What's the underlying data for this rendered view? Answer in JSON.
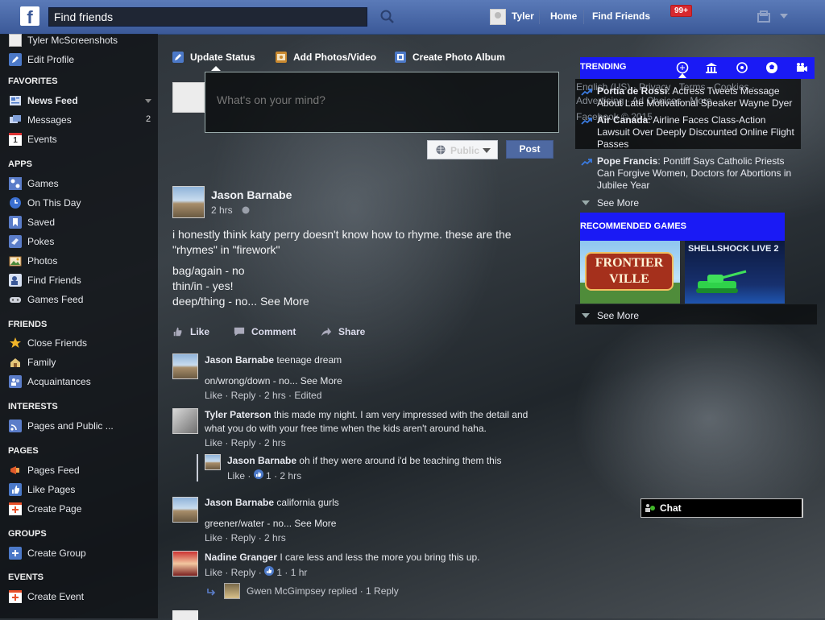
{
  "header": {
    "search_placeholder": "Find friends",
    "user_name": "Tyler",
    "home": "Home",
    "find_friends": "Find Friends",
    "notif_count": "99+"
  },
  "sidebar": {
    "profile_name": "Tyler McScreenshots",
    "edit_profile": "Edit Profile",
    "favorites_title": "FAVORITES",
    "favorites": [
      {
        "label": "News Feed",
        "icon": "news-feed-icon"
      },
      {
        "label": "Messages",
        "icon": "messages-icon",
        "count": "2"
      },
      {
        "label": "Events",
        "icon": "events-icon"
      }
    ],
    "events_icon_text": "1",
    "apps_title": "APPS",
    "apps": [
      {
        "label": "Games"
      },
      {
        "label": "On This Day"
      },
      {
        "label": "Saved"
      },
      {
        "label": "Pokes"
      },
      {
        "label": "Photos"
      },
      {
        "label": "Find Friends"
      },
      {
        "label": "Games Feed"
      }
    ],
    "friends_title": "FRIENDS",
    "friends": [
      {
        "label": "Close Friends"
      },
      {
        "label": "Family"
      },
      {
        "label": "Acquaintances"
      }
    ],
    "interests_title": "INTERESTS",
    "interests": [
      {
        "label": "Pages and Public ..."
      }
    ],
    "pages_title": "PAGES",
    "pages": [
      {
        "label": "Pages Feed"
      },
      {
        "label": "Like Pages"
      },
      {
        "label": "Create Page"
      }
    ],
    "groups_title": "GROUPS",
    "groups": [
      {
        "label": "Create Group"
      }
    ],
    "events_title": "EVENTS",
    "events": [
      {
        "label": "Create Event"
      }
    ]
  },
  "composer": {
    "tabs": [
      "Update Status",
      "Add Photos/Video",
      "Create Photo Album"
    ],
    "placeholder": "What's on your mind?",
    "privacy": "Public",
    "post": "Post"
  },
  "post": {
    "author": "Jason Barnabe",
    "time": "2 hrs",
    "text1": "i honestly think katy perry doesn't know how to rhyme. these are the \"rhymes\" in \"firework\"",
    "line2": "bag/again - no",
    "line3": "thin/in - yes!",
    "line4": "deep/thing - no...",
    "see_more": "See More",
    "actions": {
      "like": "Like",
      "comment": "Comment",
      "share": "Share"
    }
  },
  "comments": [
    {
      "author": "Jason Barnabe",
      "text": "teenage dream",
      "text2": "on/wrong/down - no...",
      "see_more": "See More",
      "meta": "Like · Reply · 2 hrs · Edited"
    },
    {
      "author": "Tyler Paterson",
      "text": "this made my night. I am very impressed with the detail and",
      "text2": "what you do with your free time when the kids aren't around haha.",
      "meta": "Like · Reply · 2 hrs"
    },
    {
      "author": "Jason Barnabe",
      "text": "oh if they were around i'd be teaching them this",
      "meta_like": "Like ·",
      "likes": "1",
      "meta_rest": "· 2 hrs"
    },
    {
      "author": "Jason Barnabe",
      "text": "california gurls",
      "text2": "greener/water - no...",
      "see_more": "See More",
      "meta": "Like · Reply · 2 hrs"
    },
    {
      "author": "Nadine Granger",
      "text": "I care less and less the more you bring this up.",
      "meta_like": "Like · Reply ·",
      "likes": "1",
      "meta_rest": "· 1 hr"
    }
  ],
  "replies_summary": {
    "text": "Gwen McGimpsey replied · 1 Reply"
  },
  "trending": {
    "title": "TRENDING",
    "footer_line1": "English (US) · Privacy · Terms · Cookies ·",
    "footer_line2": "Advertising · Ad Choices · More",
    "footer_line3": "Facebook © 2015",
    "items": [
      {
        "title": "Portia de Rossi",
        "text": ": Actress Tweets Message About Late Motivational Speaker Wayne Dyer"
      },
      {
        "title": "Air Canada",
        "text": ": Airline Faces Class-Action Lawsuit Over Deeply Discounted Online Flight Passes"
      },
      {
        "title": "Pope Francis",
        "text": ": Pontiff Says Catholic Priests Can Forgive Women, Doctors for Abortions in Jubilee Year"
      }
    ],
    "see_more": "See More"
  },
  "games": {
    "title": "RECOMMENDED GAMES",
    "frontier": "FRONTIER VILLE",
    "shellshock": "SHELLSHOCK LIVE 2",
    "see_more": "See More"
  },
  "chat": {
    "label": "Chat"
  },
  "colors": {
    "brand": "#3b5998",
    "accent": "#1a1af5",
    "badge": "#d8282f"
  }
}
